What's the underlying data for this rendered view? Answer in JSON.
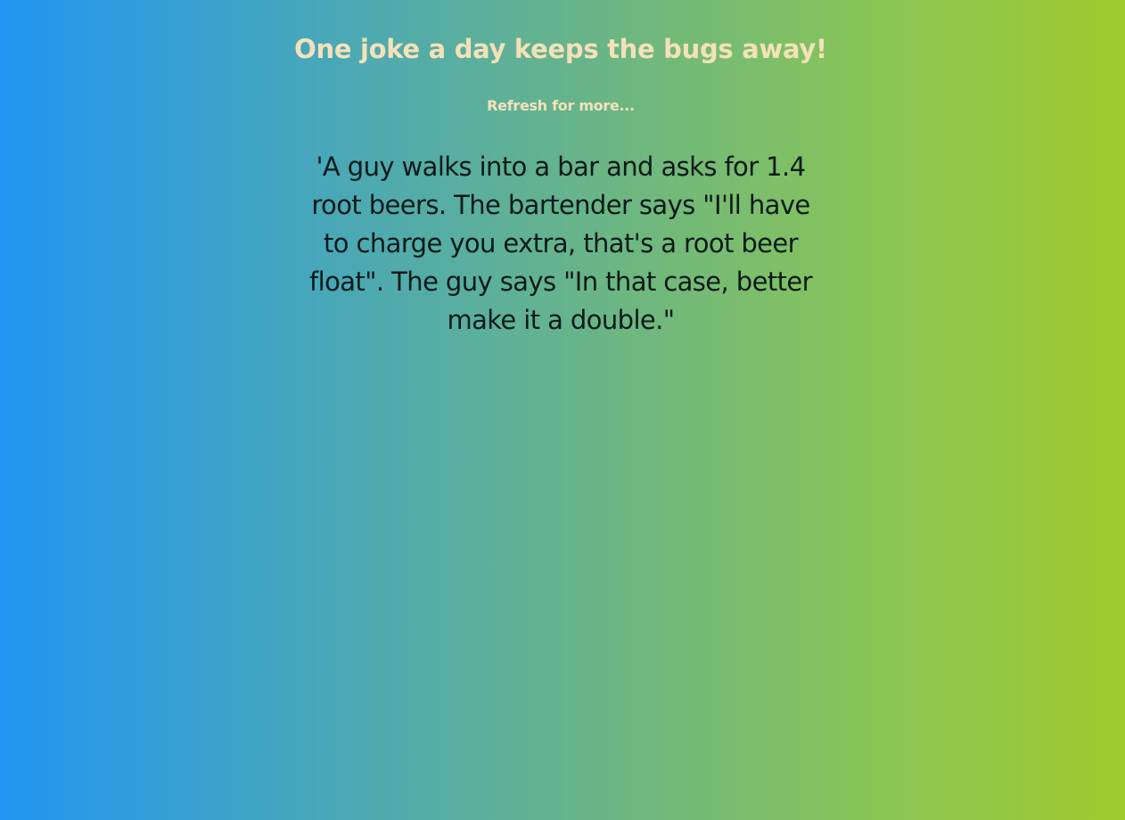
{
  "header": {
    "title": "One joke a day keeps the bugs away!",
    "subtitle": "Refresh for more..."
  },
  "joke": {
    "text": "'A guy walks into a bar and asks for 1.4 root beers. The bartender says \"I'll have to charge you extra, that's a root beer float\". The guy says \"In that case, better make it a double.\""
  },
  "colors": {
    "gradient_start": "#2196f3",
    "gradient_end": "#a0ca2e",
    "heading": "#f5e1b8",
    "joke_text": "#0b1a1a"
  }
}
